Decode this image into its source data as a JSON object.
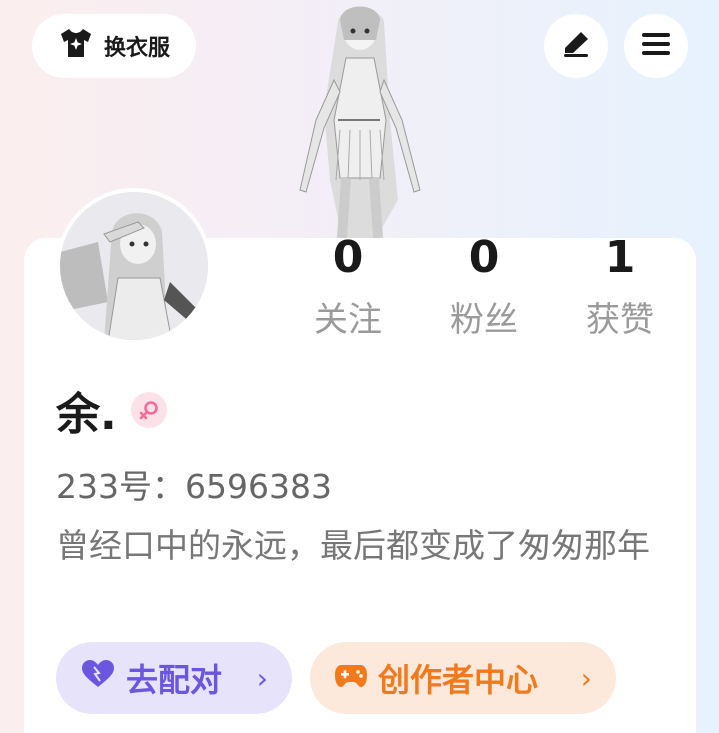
{
  "header": {
    "dress_up_label": "换衣服",
    "dress_up_icon": "tshirt-icon",
    "edit_icon": "pencil-icon",
    "menu_icon": "menu-icon"
  },
  "profile": {
    "name": "余.",
    "gender_icon": "female-icon",
    "uid": "233号：6596383",
    "bio": "曾经口中的永远，最后都变成了匆匆那年"
  },
  "stats": [
    {
      "value": "0",
      "label": "关注"
    },
    {
      "value": "0",
      "label": "粉丝"
    },
    {
      "value": "1",
      "label": "获赞"
    }
  ],
  "actions": {
    "match_label": "去配对",
    "creator_label": "创作者中心",
    "chevron": "›"
  },
  "colors": {
    "match_accent": "#6b56e0",
    "creator_accent": "#f07a1c",
    "female": "#f56b98"
  }
}
